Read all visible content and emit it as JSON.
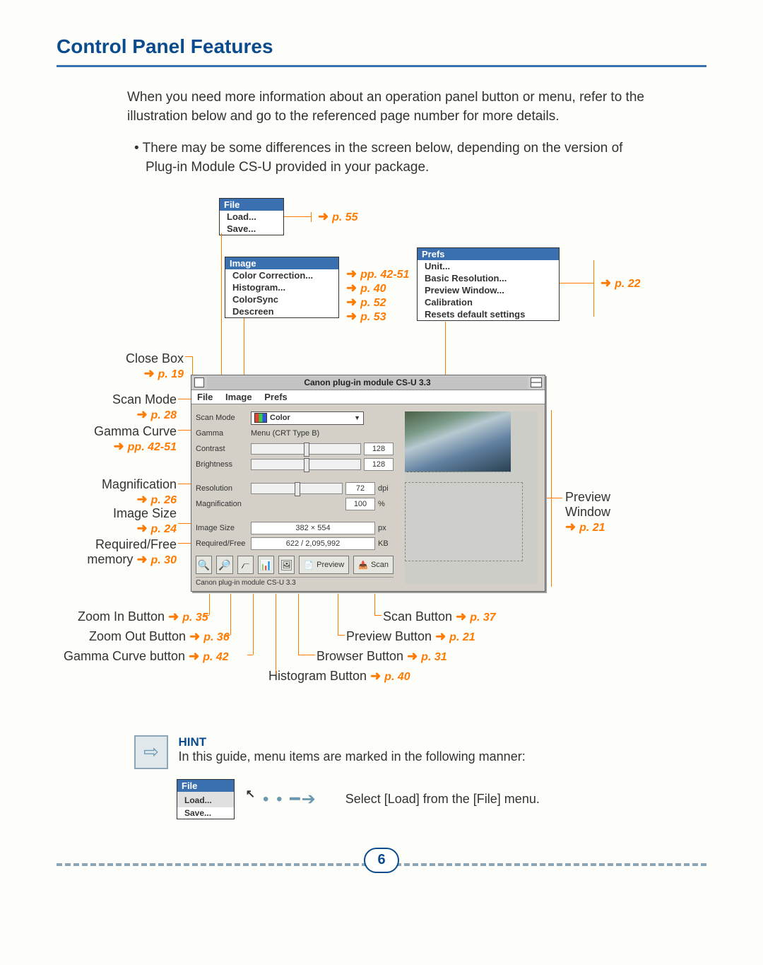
{
  "page": {
    "title": "Control Panel Features",
    "intro": "When you need more information about an operation panel button or menu, refer to the illustration below and go to the referenced page number for more details.",
    "bullet": "• There may be some differences in the screen below, depending on the version of Plug-in Module CS-U provided in your package.",
    "number": "6"
  },
  "menus": {
    "file": {
      "title": "File",
      "items": [
        "Load...",
        "Save..."
      ],
      "ref": "p. 55"
    },
    "image": {
      "title": "Image",
      "items": [
        "Color Correction...",
        "Histogram...",
        "ColorSync",
        "Descreen"
      ],
      "refs": [
        "pp. 42-51",
        "p. 40",
        "p. 52",
        "p. 53"
      ]
    },
    "prefs": {
      "title": "Prefs",
      "items": [
        "Unit...",
        "Basic Resolution...",
        "Preview Window...",
        "Calibration",
        "Resets default settings"
      ],
      "ref": "p. 22"
    }
  },
  "labels": {
    "close_box": "Close Box",
    "close_box_ref": "p. 19",
    "scan_mode": "Scan Mode",
    "scan_mode_ref": "p. 28",
    "gamma_curve": "Gamma Curve",
    "gamma_curve_ref": "pp. 42-51",
    "magnification": "Magnification",
    "magnification_ref": "p. 26",
    "image_size": "Image Size",
    "image_size_ref": "p. 24",
    "required_free": "Required/Free",
    "required_free2": "memory",
    "required_free_ref": "p. 30",
    "preview_window": "Preview",
    "preview_window2": "Window",
    "preview_window_ref": "p. 21",
    "zoom_in": "Zoom In Button",
    "zoom_in_ref": "p. 35",
    "zoom_out": "Zoom Out Button",
    "zoom_out_ref": "p. 36",
    "gamma_btn": "Gamma Curve button",
    "gamma_btn_ref": "p. 42",
    "hist_btn": "Histogram Button",
    "hist_btn_ref": "p. 40",
    "browser_btn": "Browser Button",
    "browser_btn_ref": "p. 31",
    "preview_btn": "Preview Button",
    "preview_btn_ref": "p. 21",
    "scan_btn": "Scan Button",
    "scan_btn_ref": "p. 37"
  },
  "panel": {
    "window_title": "Canon plug-in module CS-U 3.3",
    "menubar": {
      "file": "File",
      "image": "Image",
      "prefs": "Prefs"
    },
    "rows": {
      "scan_mode_lbl": "Scan Mode",
      "scan_mode_val": "Color",
      "gamma_lbl": "Gamma",
      "gamma_val": "Menu (CRT Type B)",
      "contrast_lbl": "Contrast",
      "contrast_val": "128",
      "brightness_lbl": "Brightness",
      "brightness_val": "128",
      "resolution_lbl": "Resolution",
      "resolution_val": "72",
      "resolution_unit": "dpi",
      "magnification_lbl": "Magnification",
      "magnification_val": "100",
      "magnification_unit": "%",
      "image_size_lbl": "Image Size",
      "image_size_val": "382 × 554",
      "image_size_unit": "px",
      "reqfree_lbl": "Required/Free",
      "reqfree_val": "622 / 2,095,992",
      "reqfree_unit": "KB"
    },
    "buttons": {
      "preview": "Preview",
      "scan": "Scan"
    },
    "status": "Canon plug-in module CS-U 3.3"
  },
  "hint": {
    "title": "HINT",
    "text": "In this guide, menu items are marked in the following manner:",
    "action": "Select [Load] from the [File] menu.",
    "mini": {
      "title": "File",
      "item1": "Load...",
      "item2": "Save..."
    }
  }
}
